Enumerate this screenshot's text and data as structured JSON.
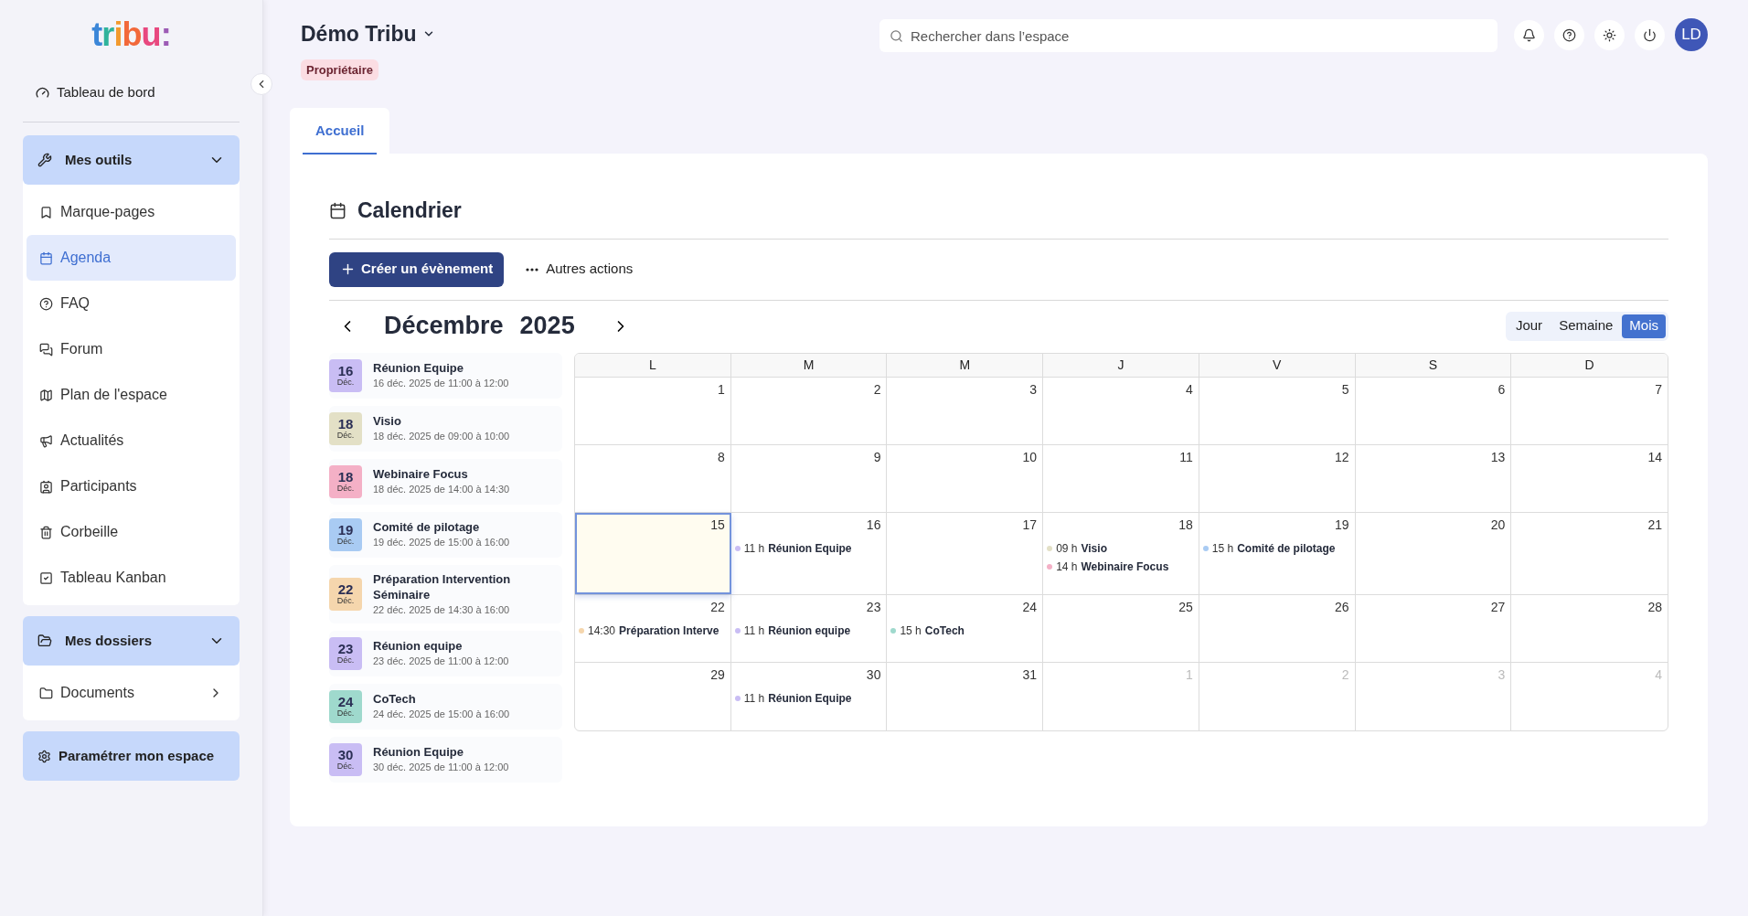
{
  "logo": [
    {
      "text": "t",
      "color": "#3b86d8"
    },
    {
      "text": "r",
      "color": "#2fb39c"
    },
    {
      "text": "i",
      "color": "#f29a2e"
    },
    {
      "text": "b",
      "color": "#f2683a"
    },
    {
      "text": "u",
      "color": "#e8487f"
    },
    {
      "text": ":",
      "color": "#9c5bb5"
    }
  ],
  "sidebar": {
    "top_item": {
      "label": "Tableau de bord"
    },
    "sections": [
      {
        "title": "Mes outils",
        "expanded": true,
        "items": [
          {
            "label": "Marque-pages",
            "selected": false
          },
          {
            "label": "Agenda",
            "selected": true
          },
          {
            "label": "FAQ",
            "selected": false
          },
          {
            "label": "Forum",
            "selected": false
          },
          {
            "label": "Plan de l'espace",
            "selected": false
          },
          {
            "label": "Actualités",
            "selected": false
          },
          {
            "label": "Participants",
            "selected": false
          },
          {
            "label": "Corbeille",
            "selected": false
          },
          {
            "label": "Tableau Kanban",
            "selected": false
          }
        ]
      },
      {
        "title": "Mes dossiers",
        "expanded": true,
        "items": [
          {
            "label": "Documents",
            "selected": false
          }
        ]
      }
    ],
    "settings_button": "Paramétrer mon espace"
  },
  "header": {
    "space_title": "Démo Tribu",
    "role_badge": "Propriétaire",
    "search": {
      "placeholder": "Rechercher dans l’espace"
    },
    "avatar": "LD"
  },
  "tabs": [
    {
      "label": "Accueil",
      "selected": true
    }
  ],
  "calendar": {
    "title": "Calendrier",
    "create_button": "Créer un évènement",
    "more_actions": "Autres actions",
    "month": "Décembre",
    "year": "2025",
    "views": [
      {
        "label": "Jour",
        "selected": false
      },
      {
        "label": "Semaine",
        "selected": false
      },
      {
        "label": "Mois",
        "selected": true
      }
    ],
    "upcoming": [
      {
        "day": "16",
        "month": "Déc.",
        "title": "Réunion Equipe",
        "when": "16 déc. 2025 de 11:00 à 12:00",
        "color": "#c9bdf4"
      },
      {
        "day": "18",
        "month": "Déc.",
        "title": "Visio",
        "when": "18 déc. 2025 de 09:00 à 10:00",
        "color": "#e3e0c6"
      },
      {
        "day": "18",
        "month": "Déc.",
        "title": "Webinaire Focus",
        "when": "18 déc. 2025 de 14:00 à 14:30",
        "color": "#f4b0c6"
      },
      {
        "day": "19",
        "month": "Déc.",
        "title": "Comité de pilotage",
        "when": "19 déc. 2025 de 15:00 à 16:00",
        "color": "#a9cbf3"
      },
      {
        "day": "22",
        "month": "Déc.",
        "title": "Préparation Intervention Séminaire",
        "when": "22 déc. 2025 de 14:30 à 16:00",
        "color": "#f5d6ad"
      },
      {
        "day": "23",
        "month": "Déc.",
        "title": "Réunion equipe",
        "when": "23 déc. 2025 de 11:00 à 12:00",
        "color": "#c9bdf4"
      },
      {
        "day": "24",
        "month": "Déc.",
        "title": "CoTech",
        "when": "24 déc. 2025 de 15:00 à 16:00",
        "color": "#9fd9cd"
      },
      {
        "day": "30",
        "month": "Déc.",
        "title": "Réunion Equipe",
        "when": "30 déc. 2025 de 11:00 à 12:00",
        "color": "#c9bdf4"
      }
    ],
    "weekdays": [
      "L",
      "M",
      "M",
      "J",
      "V",
      "S",
      "D"
    ],
    "weeks": [
      [
        {
          "day": "1",
          "outside": false,
          "selected": false
        },
        {
          "day": "2",
          "outside": false,
          "selected": false
        },
        {
          "day": "3",
          "outside": false,
          "selected": false
        },
        {
          "day": "4",
          "outside": false,
          "selected": false
        },
        {
          "day": "5",
          "outside": false,
          "selected": false
        },
        {
          "day": "6",
          "outside": false,
          "selected": false
        },
        {
          "day": "7",
          "outside": false,
          "selected": false
        }
      ],
      [
        {
          "day": "8",
          "outside": false,
          "selected": false
        },
        {
          "day": "9",
          "outside": false,
          "selected": false
        },
        {
          "day": "10",
          "outside": false,
          "selected": false
        },
        {
          "day": "11",
          "outside": false,
          "selected": false
        },
        {
          "day": "12",
          "outside": false,
          "selected": false
        },
        {
          "day": "13",
          "outside": false,
          "selected": false
        },
        {
          "day": "14",
          "outside": false,
          "selected": false
        }
      ],
      [
        {
          "day": "15",
          "outside": false,
          "selected": true
        },
        {
          "day": "16",
          "outside": false,
          "selected": false,
          "events": [
            {
              "time": "11 h",
              "title": "Réunion Equipe",
              "color": "#c9bdf4"
            }
          ]
        },
        {
          "day": "17",
          "outside": false,
          "selected": false
        },
        {
          "day": "18",
          "outside": false,
          "selected": false,
          "events": [
            {
              "time": "09 h",
              "title": "Visio",
              "color": "#e3e0c6"
            },
            {
              "time": "14 h",
              "title": "Webinaire Focus",
              "color": "#f4b0c6"
            }
          ]
        },
        {
          "day": "19",
          "outside": false,
          "selected": false,
          "events": [
            {
              "time": "15 h",
              "title": "Comité de pilotage",
              "color": "#a9cbf3"
            }
          ]
        },
        {
          "day": "20",
          "outside": false,
          "selected": false
        },
        {
          "day": "21",
          "outside": false,
          "selected": false
        }
      ],
      [
        {
          "day": "22",
          "outside": false,
          "selected": false,
          "events": [
            {
              "time": "14:30",
              "title": "Préparation Interve",
              "color": "#f5d6ad"
            }
          ]
        },
        {
          "day": "23",
          "outside": false,
          "selected": false,
          "events": [
            {
              "time": "11 h",
              "title": "Réunion equipe",
              "color": "#c9bdf4"
            }
          ]
        },
        {
          "day": "24",
          "outside": false,
          "selected": false,
          "events": [
            {
              "time": "15 h",
              "title": "CoTech",
              "color": "#9fd9cd"
            }
          ]
        },
        {
          "day": "25",
          "outside": false,
          "selected": false
        },
        {
          "day": "26",
          "outside": false,
          "selected": false
        },
        {
          "day": "27",
          "outside": false,
          "selected": false
        },
        {
          "day": "28",
          "outside": false,
          "selected": false
        }
      ],
      [
        {
          "day": "29",
          "outside": false,
          "selected": false
        },
        {
          "day": "30",
          "outside": false,
          "selected": false,
          "events": [
            {
              "time": "11 h",
              "title": "Réunion Equipe",
              "color": "#c9bdf4"
            }
          ]
        },
        {
          "day": "31",
          "outside": false,
          "selected": false
        },
        {
          "day": "1",
          "outside": true,
          "selected": false
        },
        {
          "day": "2",
          "outside": true,
          "selected": false
        },
        {
          "day": "3",
          "outside": true,
          "selected": false
        },
        {
          "day": "4",
          "outside": true,
          "selected": false
        }
      ]
    ]
  }
}
